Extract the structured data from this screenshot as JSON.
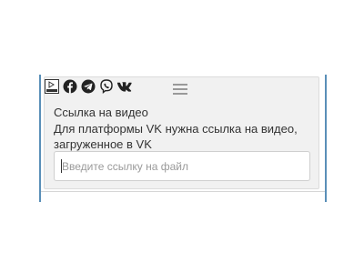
{
  "toolbar": {
    "icons": [
      "video-file-icon",
      "facebook-icon",
      "telegram-icon",
      "viber-icon",
      "vk-icon"
    ],
    "drag_handle_icon": "menu-icon"
  },
  "block": {
    "title": "Ссылка на видео",
    "description": "Для платформы VK нужна ссылка на видео, загруженное в VK",
    "input_value": "",
    "input_placeholder": "Введите ссылку на файл"
  },
  "colors": {
    "panel_bg": "#f1f1f1",
    "frame_accent": "#5a8fb8",
    "text": "#333333"
  }
}
